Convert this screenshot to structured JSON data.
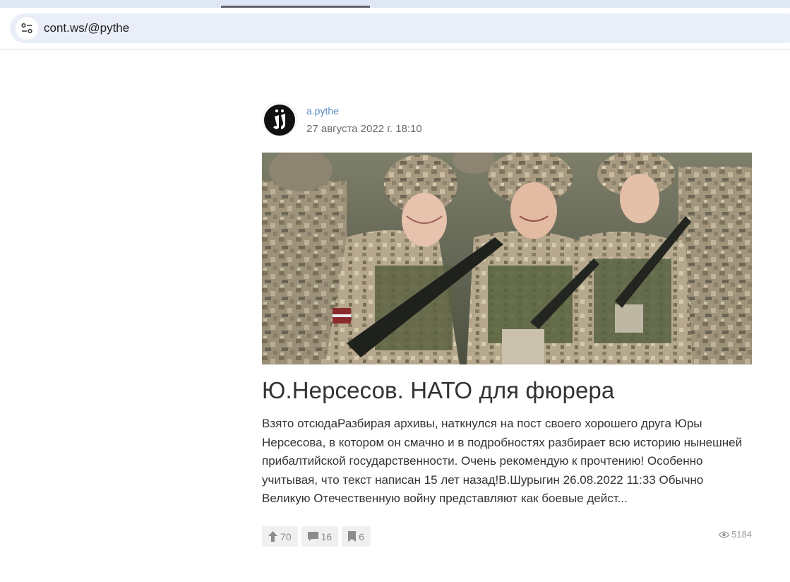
{
  "browser": {
    "url": "cont.ws/@pythe"
  },
  "post": {
    "author": "a.pythe",
    "date": "27 августа 2022 г. 18:10",
    "title": "Ю.Нерсесов. НАТО для фюрера",
    "excerpt": "Взято отсюдаРазбирая архивы, наткнулся на пост своего хорошего друга Юры Нерсесова, в котором он смачно и в подробностях разбирает всю историю нынешней прибалтийской государственности. Очень рекомендую к прочтению! Особенно учитывая, что текст написан 15 лет назад!В.Шурыгин 26.08.2022 11:33 Обычно Великую Отечественную войну представляют как боевые дейст...",
    "upvotes": "70",
    "comments": "16",
    "bookmarks": "6",
    "views": "5184"
  },
  "colors": {
    "author_link": "#5a8cc4",
    "action_bg": "#f0f0f0",
    "omnibox_bg": "#e9eef8"
  },
  "icons": [
    "site-info-icon",
    "arrow-up-icon",
    "comment-icon",
    "bookmark-icon",
    "eye-icon"
  ]
}
